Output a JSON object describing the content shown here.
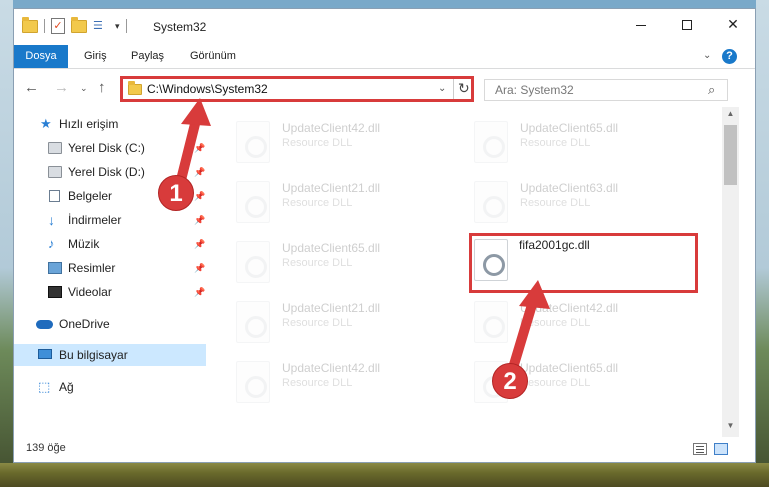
{
  "window": {
    "title": "System32"
  },
  "ribbon": {
    "tabs": [
      "Dosya",
      "Giriş",
      "Paylaş",
      "Görünüm"
    ],
    "help": "?"
  },
  "nav": {
    "address": "C:\\Windows\\System32",
    "search_placeholder": "Ara: System32"
  },
  "sidebar": {
    "items": [
      {
        "label": "Hızlı erişim",
        "icon": "star-icon"
      },
      {
        "label": "Yerel Disk (C:)",
        "icon": "disk-icon",
        "pinned": true
      },
      {
        "label": "Yerel Disk (D:)",
        "icon": "disk-icon",
        "pinned": true
      },
      {
        "label": "Belgeler",
        "icon": "document-icon",
        "pinned": true
      },
      {
        "label": "İndirmeler",
        "icon": "download-icon",
        "pinned": true
      },
      {
        "label": "Müzik",
        "icon": "music-icon",
        "pinned": true
      },
      {
        "label": "Resimler",
        "icon": "pictures-icon",
        "pinned": true
      },
      {
        "label": "Videolar",
        "icon": "video-icon",
        "pinned": true
      },
      {
        "label": "OneDrive",
        "icon": "cloud-icon"
      },
      {
        "label": "Bu bilgisayar",
        "icon": "computer-icon",
        "selected": true
      },
      {
        "label": "Ağ",
        "icon": "network-icon"
      }
    ]
  },
  "files": [
    {
      "name": "UpdateClient42.dll",
      "type": "Resource DLL"
    },
    {
      "name": "UpdateClient65.dll",
      "type": "Resource DLL"
    },
    {
      "name": "UpdateClient21.dll",
      "type": "Resource DLL"
    },
    {
      "name": "UpdateClient63.dll",
      "type": "Resource DLL"
    },
    {
      "name": "UpdateClient65.dll",
      "type": "Resource DLL"
    },
    {
      "name": "fifa2001gc.dll",
      "type": ""
    },
    {
      "name": "UpdateClient21.dll",
      "type": "Resource DLL"
    },
    {
      "name": "UpdateClient42.dll",
      "type": "Resource DLL"
    },
    {
      "name": "UpdateClient42.dll",
      "type": "Resource DLL"
    },
    {
      "name": "UpdateClient65.dll",
      "type": "Resource DLL"
    }
  ],
  "status": {
    "count": "139 öğe"
  },
  "annotations": {
    "step1": "1",
    "step2": "2",
    "color": "#d83b3b"
  }
}
